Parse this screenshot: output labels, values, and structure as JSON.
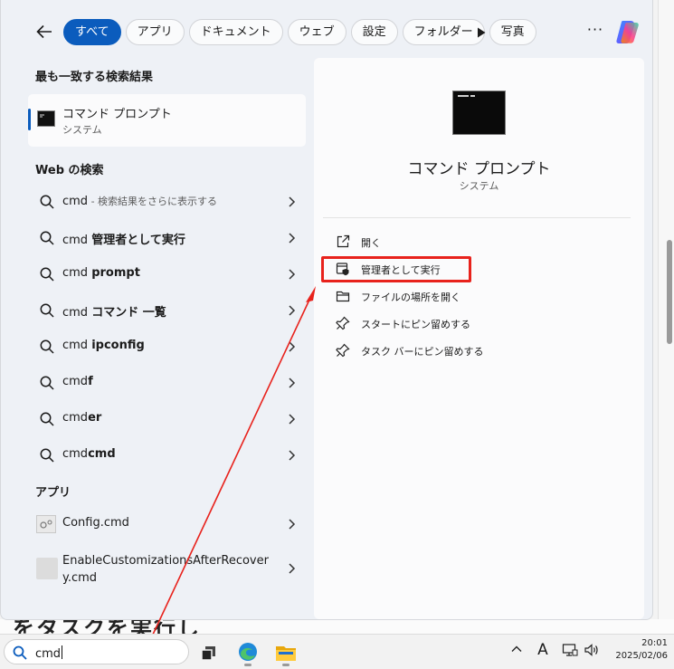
{
  "filters": {
    "tabs": [
      {
        "label": "すべて",
        "active": true
      },
      {
        "label": "アプリ",
        "active": false
      },
      {
        "label": "ドキュメント",
        "active": false
      },
      {
        "label": "ウェブ",
        "active": false
      },
      {
        "label": "設定",
        "active": false
      },
      {
        "label": "フォルダー",
        "active": false
      },
      {
        "label": "写真",
        "active": false
      }
    ],
    "more_label": "···"
  },
  "best_match": {
    "heading": "最も一致する検索結果",
    "name": "コマンド プロンプト",
    "type": "システム"
  },
  "web": {
    "heading": "Web の検索",
    "items": [
      {
        "prefix": "cmd",
        "bold": "",
        "hint": " - 検索結果をさらに表示する"
      },
      {
        "prefix": "cmd ",
        "bold": "管理者として実行",
        "hint": ""
      },
      {
        "prefix": "cmd ",
        "bold": "prompt",
        "hint": ""
      },
      {
        "prefix": "cmd ",
        "bold": "コマンド 一覧",
        "hint": ""
      },
      {
        "prefix": "cmd ",
        "bold": "ipconfig",
        "hint": ""
      },
      {
        "prefix": "cmd",
        "bold": "f",
        "hint": ""
      },
      {
        "prefix": "cmd",
        "bold": "er",
        "hint": ""
      },
      {
        "prefix": "cmd",
        "bold": "cmd",
        "hint": ""
      }
    ]
  },
  "apps": {
    "heading": "アプリ",
    "items": [
      {
        "name_line1": "Config.cmd",
        "name_line2": ""
      },
      {
        "name_line1": "EnableCustomizationsAfterRecover",
        "name_line2": "y.cmd"
      }
    ]
  },
  "detail": {
    "name": "コマンド プロンプト",
    "type": "システム",
    "actions": [
      {
        "label": "開く",
        "icon": "open-external-icon"
      },
      {
        "label": "管理者として実行",
        "icon": "shield-run-admin-icon"
      },
      {
        "label": "ファイルの場所を開く",
        "icon": "folder-icon"
      },
      {
        "label": "スタートにピン留めする",
        "icon": "pin-icon"
      },
      {
        "label": "タスク バーにピン留めする",
        "icon": "pin-icon"
      }
    ]
  },
  "background": {
    "strip_text": "をタスクを実行し"
  },
  "taskbar": {
    "search_value": "cmd",
    "ime_label": "A",
    "time": "20:01",
    "date": "2025/02/06"
  },
  "colors": {
    "accent": "#0b5cbd",
    "highlight_box": "#e8221c"
  }
}
